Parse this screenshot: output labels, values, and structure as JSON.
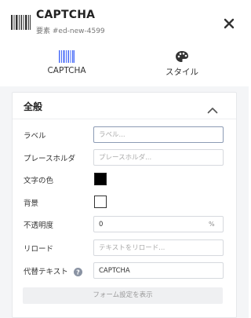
{
  "header": {
    "title": "CAPTCHA",
    "subtitle": "要素 #ed-new-4599",
    "icon": "barcode-icon",
    "close_icon": "close-icon"
  },
  "tabs": [
    {
      "label": "CAPTCHA",
      "icon": "barcode-icon",
      "active": true
    },
    {
      "label": "スタイル",
      "icon": "palette-icon",
      "active": false
    }
  ],
  "section": {
    "title": "全般",
    "collapse_icon": "chevron-up-icon",
    "fields": {
      "label": {
        "label": "ラベル",
        "value": "",
        "placeholder": "ラベル..."
      },
      "placeholder": {
        "label": "プレースホルダ",
        "value": "",
        "placeholder": "プレースホルダ..."
      },
      "text_color": {
        "label": "文字の色",
        "color": "#000000"
      },
      "background": {
        "label": "背景",
        "color": "#ffffff"
      },
      "opacity": {
        "label": "不透明度",
        "value": "0",
        "unit": "%"
      },
      "reload": {
        "label": "リロード",
        "value": "",
        "placeholder": "テキストをリロード..."
      },
      "alt_text": {
        "label": "代替テキスト",
        "value": "CAPTCHA",
        "help_icon": "help-icon"
      }
    },
    "show_form_settings": "フォーム設定を表示"
  },
  "colors": {
    "panel_bg": "#f4f5f7",
    "accent": "#4a6cf7"
  }
}
